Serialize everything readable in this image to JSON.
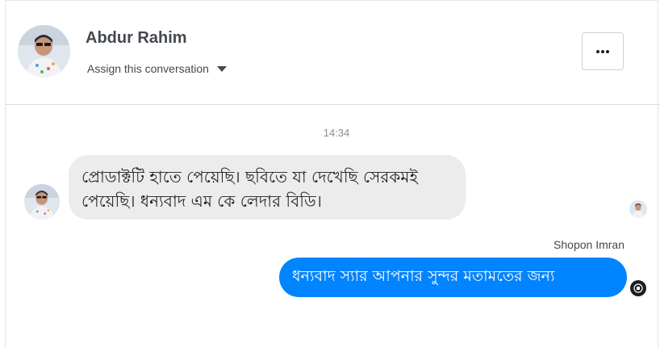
{
  "header": {
    "contact_name": "Abdur Rahim",
    "assign_label": "Assign this conversation",
    "assign_icon": "caret-down-icon",
    "more_icon": "more-horizontal-icon"
  },
  "thread": {
    "timestamp": "14:34",
    "incoming_message": "প্রোডাক্টটি হাতে পেয়েছি। ছবিতে যা দেখেছি সেরকমই পেয়েছি। ধন্যবাদ এম কে লেদার বিডি।",
    "outgoing_sender": "Shopon Imran",
    "outgoing_message": "ধন্যবাদ স্যার আপনার সুন্দর মতামতের জন্য"
  },
  "colors": {
    "outgoing_bubble": "#0084ff",
    "incoming_bubble": "#ececec",
    "text_secondary": "#444950",
    "timestamp": "#8a8d91"
  }
}
